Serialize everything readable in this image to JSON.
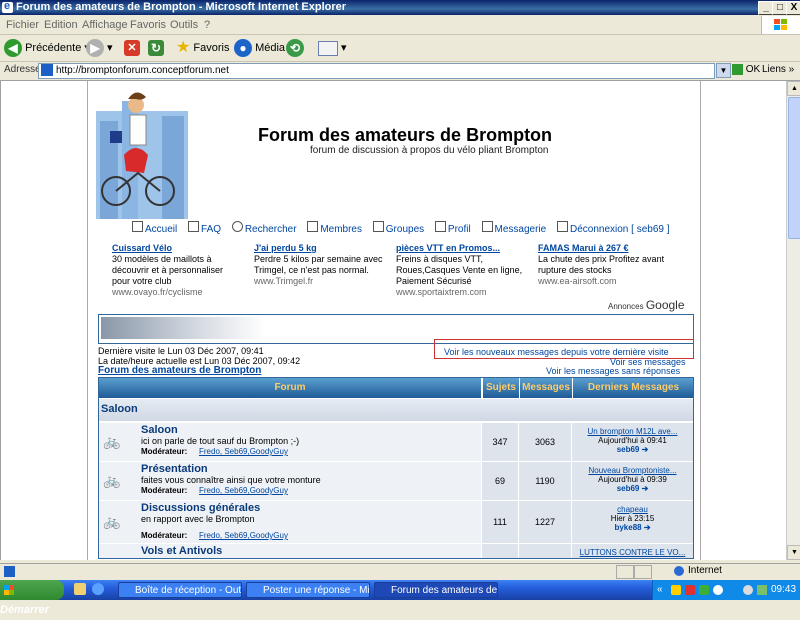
{
  "window": {
    "title": "Forum des amateurs de Brompton - Microsoft Internet Explorer",
    "minimize": "_",
    "maximize": "□",
    "close": "X"
  },
  "menu": [
    "Fichier",
    "Edition",
    "Affichage",
    "Favoris",
    "Outils",
    "?"
  ],
  "toolbar": {
    "back": "Précédente",
    "favorites": "Favoris",
    "media": "Média"
  },
  "address": {
    "label": "Adresse",
    "url": "http://bromptonforum.conceptforum.net",
    "go": "OK",
    "links": "Liens"
  },
  "header": {
    "title": "Forum des amateurs de Brompton",
    "subtitle": "forum de discussion à propos du vélo pliant Brompton"
  },
  "nav": {
    "home": "Accueil",
    "faq": "FAQ",
    "search": "Rechercher",
    "members": "Membres",
    "groups": "Groupes",
    "profile": "Profil",
    "messaging": "Messagerie",
    "logout": "Déconnexion [ seb69 ]"
  },
  "ads": [
    {
      "title": "Cuissard Vélo",
      "text": "30 modèles de maillots à découvrir et à personnaliser pour votre club",
      "url": "www.ovayo.fr/cyclisme"
    },
    {
      "title": "J'ai perdu 5 kg",
      "text": "Perdre 5 kilos par semaine avec Trimgel, ce n'est pas normal.",
      "url": "www.Trimgel.fr"
    },
    {
      "title": "pièces VTT en Promos...",
      "text": "Freins à disques VTT, Roues,Casques Vente en ligne, Paiement Sécurisé",
      "url": "www.sportaixtrem.com"
    },
    {
      "title": "FAMAS Marui à 267 €",
      "text": "La chute des prix Profitez avant rupture des stocks",
      "url": "www.ea-airsoft.com"
    }
  ],
  "ads_by": "Annonces",
  "ads_brand": "Google",
  "info": {
    "last_visit": "Dernière visite le Lun 03 Déc 2007, 09:41",
    "current_time": "La date/heure actuelle est Lun 03 Déc 2007, 09:42",
    "forum_link": "Forum des amateurs de Brompton",
    "new_since": "Voir les nouveaux messages depuis votre dernière visite",
    "your_msgs": "Voir ses messages",
    "unanswered": "Voir les messages sans réponses"
  },
  "table": {
    "headers": {
      "forum": "Forum",
      "topics": "Sujets",
      "posts": "Messages",
      "last": "Derniers Messages"
    },
    "category": "Saloon",
    "moderator_label": "Modérateur:",
    "moderators": "Fredo, Seb69,GoodyGuy",
    "rows": [
      {
        "name": "Saloon",
        "desc": "ici on parle de tout sauf du Brompton ;-)",
        "topics": "347",
        "posts": "3063",
        "last_title": "Un brompton M12L ave...",
        "last_time": "Aujourd'hui à 09:41",
        "last_user": "seb69"
      },
      {
        "name": "Présentation",
        "desc": "faites vous connaître ainsi que votre monture",
        "topics": "69",
        "posts": "1190",
        "last_title": "Nouveau Bromptoniste...",
        "last_time": "Aujourd'hui à 09:39",
        "last_user": "seb69"
      },
      {
        "name": "Discussions générales",
        "desc": "en rapport avec le Brompton",
        "topics": "111",
        "posts": "1227",
        "last_title": "chapeau",
        "last_time": "Hier à 23:15",
        "last_user": "byke88"
      },
      {
        "name": "Vols et Antivols",
        "desc": "",
        "topics": "",
        "posts": "",
        "last_title": "LUTTONS CONTRE LE VO...",
        "last_time": "",
        "last_user": ""
      }
    ]
  },
  "status": {
    "zone": "Internet"
  },
  "taskbar": {
    "start": "Démarrer",
    "tasks": [
      "Boîte de réception - Outl...",
      "Poster une réponse - Mic...",
      "Forum des amateurs de ..."
    ],
    "clock": "09:43"
  }
}
